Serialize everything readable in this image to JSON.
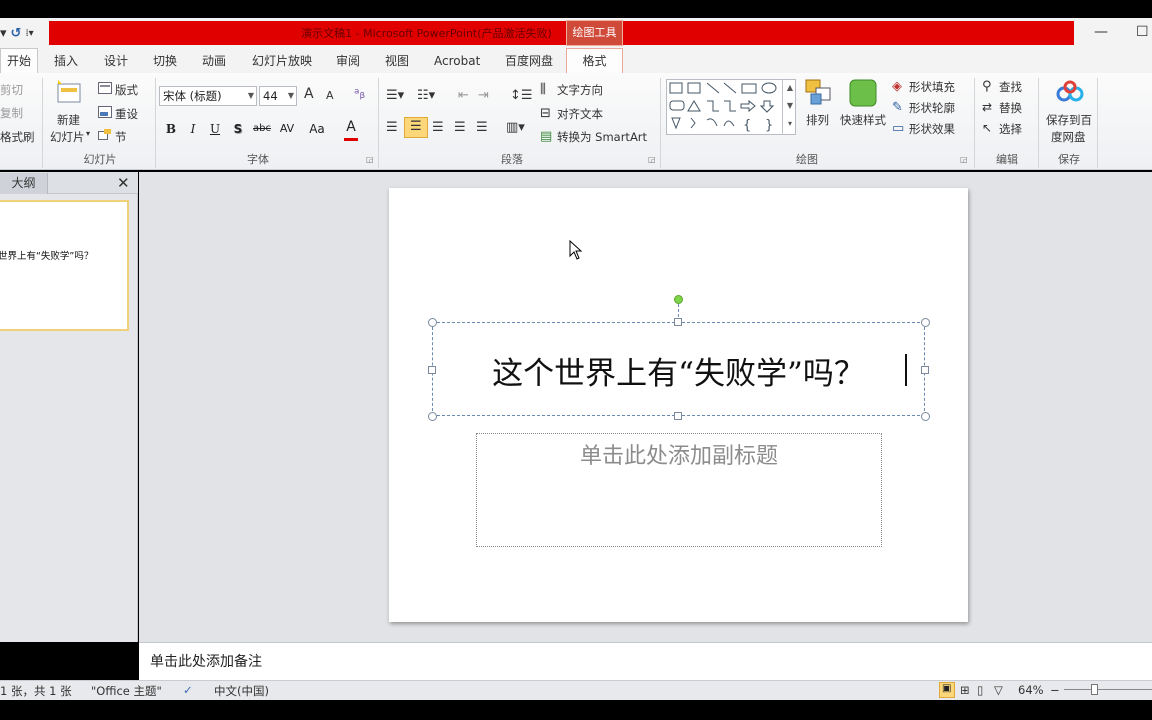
{
  "window": {
    "title": "演示文稿1 - Microsoft PowerPoint(产品激活失败)",
    "context_tool": "绘图工具",
    "min_icon": "—",
    "max_icon": "☐"
  },
  "qat": {
    "dropdown": "▾",
    "undo": "↺",
    "customize": "⁞▾"
  },
  "tabs": {
    "home": "开始",
    "insert": "插入",
    "design": "设计",
    "transitions": "切换",
    "animations": "动画",
    "slideshow": "幻灯片放映",
    "review": "审阅",
    "view": "视图",
    "acrobat": "Acrobat",
    "baidu": "百度网盘",
    "format": "格式"
  },
  "ribbon": {
    "clipboard": {
      "cut": "剪切",
      "copy": "复制",
      "painter": "格式刷"
    },
    "slides": {
      "new_slide_1": "新建",
      "new_slide_2": "幻灯片",
      "layout": "版式",
      "reset": "重设",
      "section": "节",
      "label": "幻灯片"
    },
    "font": {
      "font_name": "宋体 (标题)",
      "font_size": "44",
      "grow": "A",
      "shrink": "A",
      "bold": "B",
      "italic": "I",
      "underline": "U",
      "shadow": "S",
      "strike": "abc",
      "spacing": "AV",
      "case": "Aa",
      "color": "A",
      "label": "字体"
    },
    "paragraph": {
      "text_direction": "文字方向",
      "align_text": "对齐文本",
      "smartart": "转换为 SmartArt",
      "label": "段落"
    },
    "drawing": {
      "arrange": "排列",
      "quick_styles": "快速样式",
      "fill": "形状填充",
      "outline": "形状轮廓",
      "effects": "形状效果",
      "label": "绘图"
    },
    "editing": {
      "find": "查找",
      "replace": "替换",
      "select": "选择",
      "label": "编辑"
    },
    "save": {
      "save_1": "保存到百",
      "save_2": "度网盘",
      "label": "保存"
    }
  },
  "panel": {
    "outline_tab": "大纲",
    "close": "✕",
    "thumb_text": "世界上有“失败学”吗？"
  },
  "slide": {
    "title": "这个世界上有“失败学”吗？",
    "subtitle_placeholder": "单击此处添加副标题"
  },
  "notes": {
    "placeholder": "单击此处添加备注"
  },
  "status": {
    "slide_pos": "1 张，共 1 张",
    "theme": "\"Office 主题\"",
    "language": "中文(中国)",
    "zoom": "64%",
    "zoom_out": "−"
  },
  "colors": {
    "accent_red": "#e00000",
    "context_tab": "#d04a3a",
    "rotate_handle": "#7fd44a"
  }
}
